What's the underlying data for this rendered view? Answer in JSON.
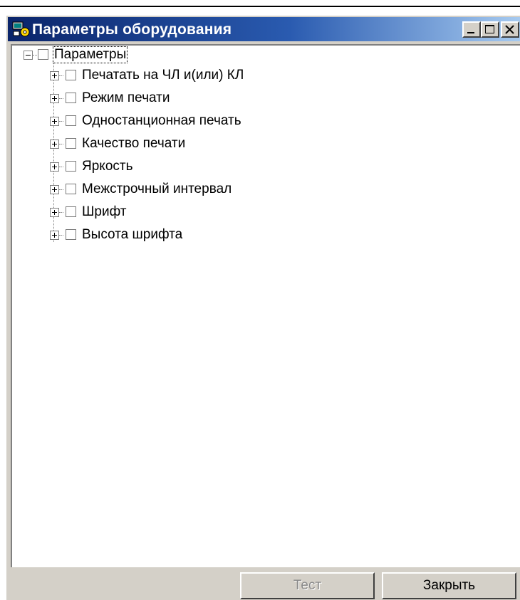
{
  "window": {
    "title": "Параметры оборудования",
    "icon": "equipment-settings-icon",
    "controls": [
      "minimize",
      "maximize",
      "close"
    ]
  },
  "tree": {
    "root": {
      "label": "Параметры",
      "expanded": true,
      "checked": false
    },
    "children": [
      {
        "label": "Печатать на ЧЛ и(или) КЛ",
        "expanded": false,
        "checked": false
      },
      {
        "label": "Режим печати",
        "expanded": false,
        "checked": false
      },
      {
        "label": "Одностанционная печать",
        "expanded": false,
        "checked": false
      },
      {
        "label": "Качество печати",
        "expanded": false,
        "checked": false
      },
      {
        "label": "Яркость",
        "expanded": false,
        "checked": false
      },
      {
        "label": "Межстрочный интервал",
        "expanded": false,
        "checked": false
      },
      {
        "label": "Шрифт",
        "expanded": false,
        "checked": false
      },
      {
        "label": "Высота шрифта",
        "expanded": false,
        "checked": false
      }
    ]
  },
  "buttons": {
    "test": {
      "label": "Тест",
      "enabled": false
    },
    "close": {
      "label": "Закрыть",
      "enabled": true
    }
  },
  "colors": {
    "title_gradient_start": "#0a246a",
    "title_gradient_end": "#a6caf0",
    "face": "#d4d0c8"
  }
}
